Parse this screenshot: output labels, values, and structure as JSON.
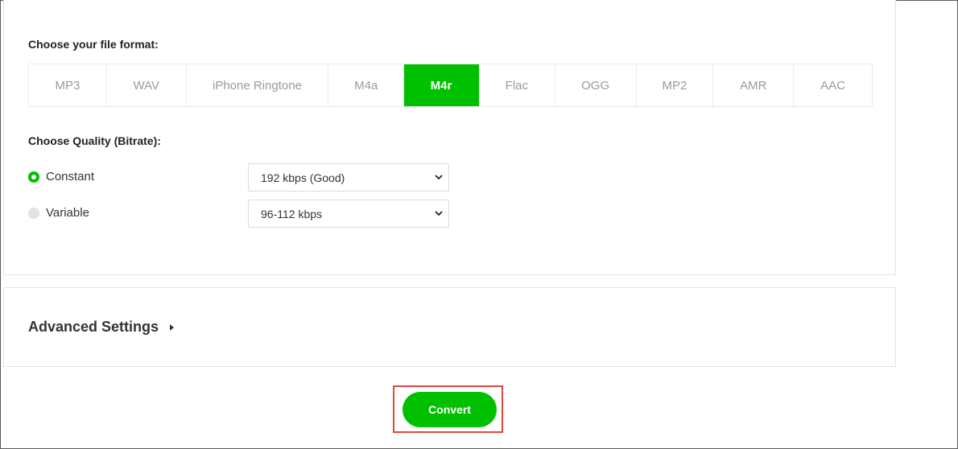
{
  "format_section": {
    "label": "Choose your file format:",
    "formats": [
      {
        "label": "MP3",
        "width": 97
      },
      {
        "label": "WAV",
        "width": 99
      },
      {
        "label": "iPhone Ringtone",
        "width": 177
      },
      {
        "label": "M4a",
        "width": 94
      },
      {
        "label": "M4r",
        "width": 93
      },
      {
        "label": "Flac",
        "width": 95
      },
      {
        "label": "OGG",
        "width": 101
      },
      {
        "label": "MP2",
        "width": 96
      },
      {
        "label": "AMR",
        "width": 100
      },
      {
        "label": "AAC",
        "width": 97
      }
    ],
    "selected": "M4r"
  },
  "quality_section": {
    "label": "Choose Quality (Bitrate):",
    "constant": {
      "label": "Constant",
      "checked": true,
      "selected_value": "192 kbps (Good)"
    },
    "variable": {
      "label": "Variable",
      "checked": false,
      "selected_value": "96-112 kbps"
    }
  },
  "advanced": {
    "title": "Advanced Settings",
    "caret_icon": "caret-right-icon"
  },
  "convert": {
    "label": "Convert"
  },
  "colors": {
    "accent": "#00c000",
    "highlight": "#e0463a"
  }
}
